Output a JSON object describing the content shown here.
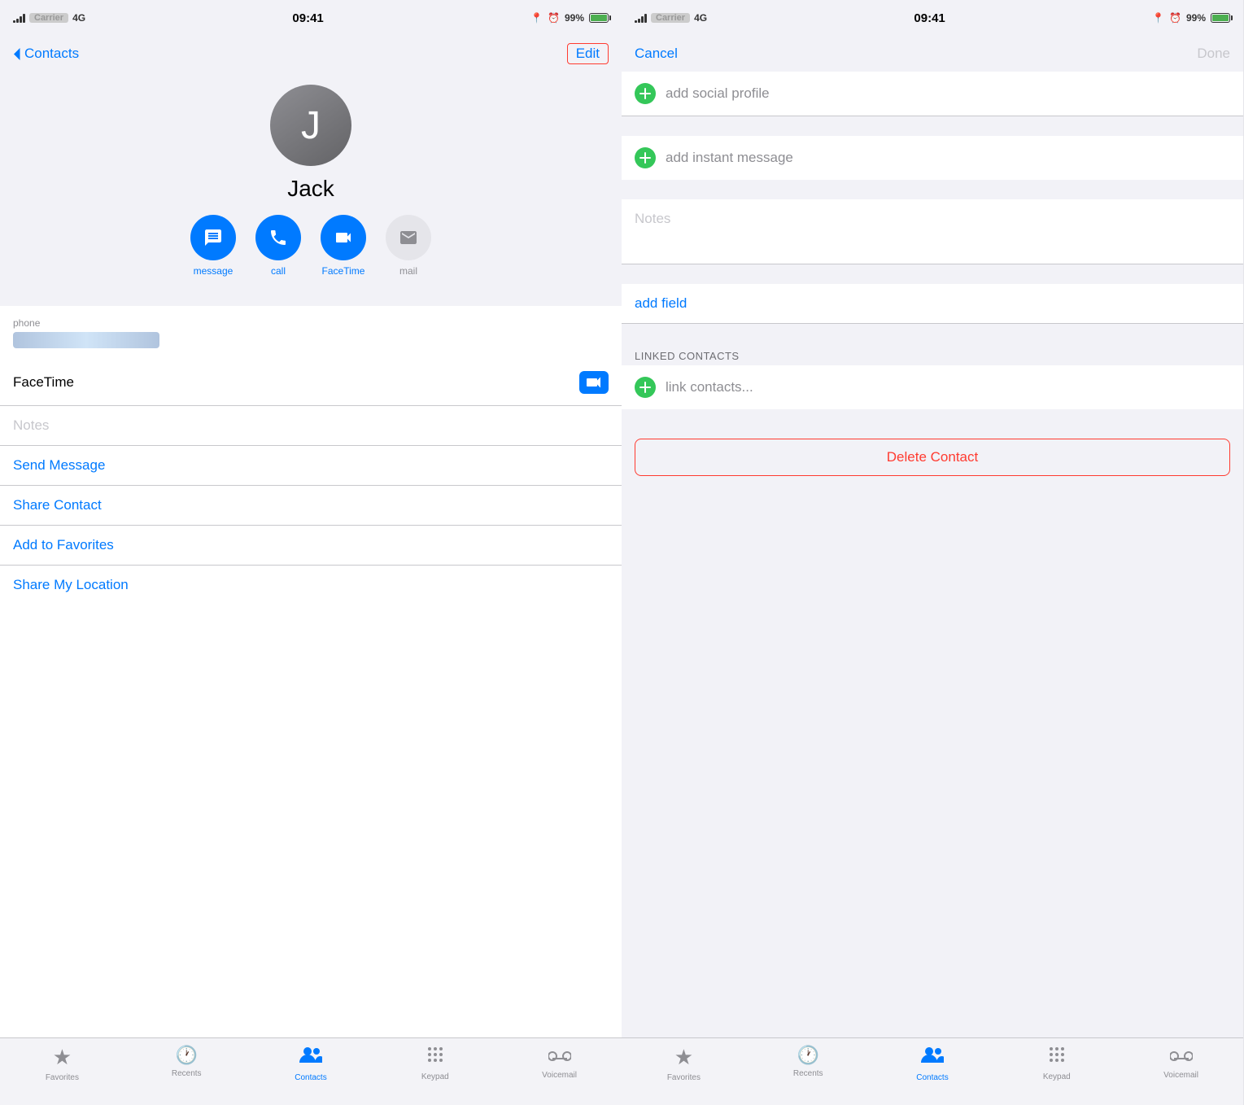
{
  "left": {
    "statusBar": {
      "carrier": "Carrier",
      "network": "4G",
      "time": "09:41",
      "battery": "99%"
    },
    "navBar": {
      "backLabel": "Contacts",
      "editLabel": "Edit"
    },
    "contact": {
      "initial": "J",
      "name": "Jack"
    },
    "actions": [
      {
        "id": "message",
        "label": "message",
        "type": "blue"
      },
      {
        "id": "call",
        "label": "call",
        "type": "blue"
      },
      {
        "id": "facetime",
        "label": "FaceTime",
        "type": "blue"
      },
      {
        "id": "mail",
        "label": "mail",
        "type": "gray"
      }
    ],
    "phone": {
      "label": "phone",
      "value": "redacted"
    },
    "facetimeLabel": "FaceTime",
    "notesPlaceholder": "Notes",
    "listItems": [
      {
        "id": "send-message",
        "label": "Send Message"
      },
      {
        "id": "share-contact",
        "label": "Share Contact"
      },
      {
        "id": "add-favorites",
        "label": "Add to Favorites"
      },
      {
        "id": "share-location",
        "label": "Share My Location"
      }
    ],
    "tabBar": {
      "items": [
        {
          "id": "favorites",
          "label": "Favorites",
          "icon": "★",
          "active": false
        },
        {
          "id": "recents",
          "label": "Recents",
          "icon": "🕐",
          "active": false
        },
        {
          "id": "contacts",
          "label": "Contacts",
          "icon": "👥",
          "active": true
        },
        {
          "id": "keypad",
          "label": "Keypad",
          "icon": "⠿",
          "active": false
        },
        {
          "id": "voicemail",
          "label": "Voicemail",
          "icon": "⏮",
          "active": false
        }
      ]
    }
  },
  "right": {
    "statusBar": {
      "carrier": "Carrier",
      "network": "4G",
      "time": "09:41",
      "battery": "99%"
    },
    "navBar": {
      "cancelLabel": "Cancel",
      "doneLabel": "Done"
    },
    "editItems": [
      {
        "id": "add-social",
        "label": "add social profile"
      },
      {
        "id": "add-instant",
        "label": "add instant message"
      }
    ],
    "notesPlaceholder": "Notes",
    "addFieldLabel": "add field",
    "linkedSection": {
      "header": "LINKED CONTACTS",
      "linkLabel": "link contacts..."
    },
    "deleteLabel": "Delete Contact",
    "tabBar": {
      "items": [
        {
          "id": "favorites",
          "label": "Favorites",
          "icon": "★",
          "active": false
        },
        {
          "id": "recents",
          "label": "Recents",
          "icon": "🕐",
          "active": false
        },
        {
          "id": "contacts",
          "label": "Contacts",
          "icon": "👥",
          "active": true
        },
        {
          "id": "keypad",
          "label": "Keypad",
          "icon": "⠿",
          "active": false
        },
        {
          "id": "voicemail",
          "label": "Voicemail",
          "icon": "⏮",
          "active": false
        }
      ]
    }
  }
}
